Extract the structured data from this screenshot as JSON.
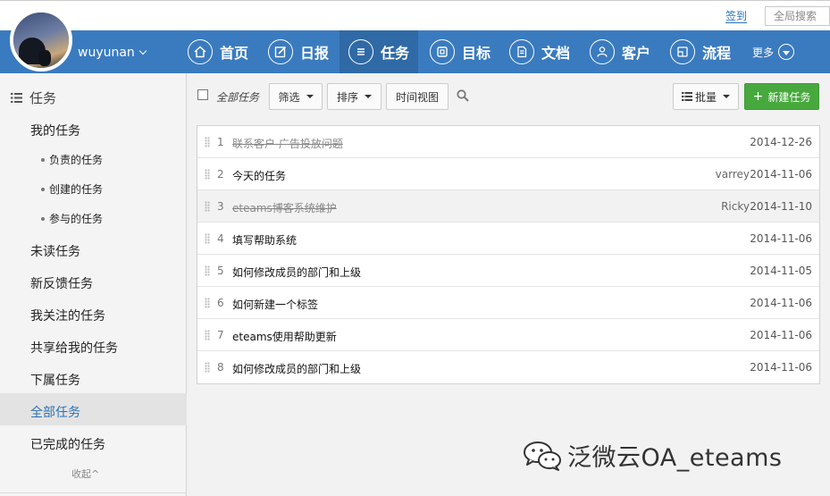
{
  "top": {
    "signin": "签到",
    "global_search": "全局搜索"
  },
  "user": {
    "name": "wuyunan"
  },
  "nav": {
    "items": [
      {
        "label": "首页",
        "icon": "home-icon"
      },
      {
        "label": "日报",
        "icon": "edit-icon"
      },
      {
        "label": "任务",
        "icon": "list-icon",
        "active": true
      },
      {
        "label": "目标",
        "icon": "target-icon"
      },
      {
        "label": "文档",
        "icon": "document-icon"
      },
      {
        "label": "客户",
        "icon": "user-icon"
      },
      {
        "label": "流程",
        "icon": "flow-icon"
      }
    ],
    "more": "更多"
  },
  "sidebar": {
    "header": "任务",
    "my_tasks": "我的任务",
    "subitems": [
      "负责的任务",
      "创建的任务",
      "参与的任务"
    ],
    "items": [
      "未读任务",
      "新反馈任务",
      "我关注的任务",
      "共享给我的任务",
      "下属任务",
      "全部任务",
      "已完成的任务"
    ],
    "active": "全部任务",
    "collapse": "收起^"
  },
  "toolbar": {
    "all_tasks": "全部任务",
    "filter": "筛选",
    "sort": "排序",
    "timeline": "时间视图",
    "batch": "批量",
    "new_task": "新建任务"
  },
  "tasks": [
    {
      "num": "1",
      "title": "联系客户 广告投放问题",
      "owner": "",
      "date": "2014-12-26",
      "done": true
    },
    {
      "num": "2",
      "title": "今天的任务",
      "owner": "varrey",
      "date": "2014-11-06",
      "done": false
    },
    {
      "num": "3",
      "title": "eteams博客系统维护",
      "owner": "Ricky",
      "date": "2014-11-10",
      "done": true,
      "highlight": true
    },
    {
      "num": "4",
      "title": "填写帮助系统",
      "owner": "",
      "date": "2014-11-06",
      "done": false
    },
    {
      "num": "5",
      "title": "如何修改成员的部门和上级",
      "owner": "",
      "date": "2014-11-05",
      "done": false
    },
    {
      "num": "6",
      "title": "如何新建一个标签",
      "owner": "",
      "date": "2014-11-06",
      "done": false
    },
    {
      "num": "7",
      "title": "eteams使用帮助更新",
      "owner": "",
      "date": "2014-11-06",
      "done": false
    },
    {
      "num": "8",
      "title": "如何修改成员的部门和上级",
      "owner": "",
      "date": "2014-11-06",
      "done": false
    }
  ],
  "watermark": {
    "text": "泛微云OA_eteams"
  },
  "colors": {
    "nav_bg": "#3a7bbf",
    "nav_active": "#2f6aa6",
    "accent_link": "#2a72b5",
    "new_task_green": "#47a93d"
  }
}
